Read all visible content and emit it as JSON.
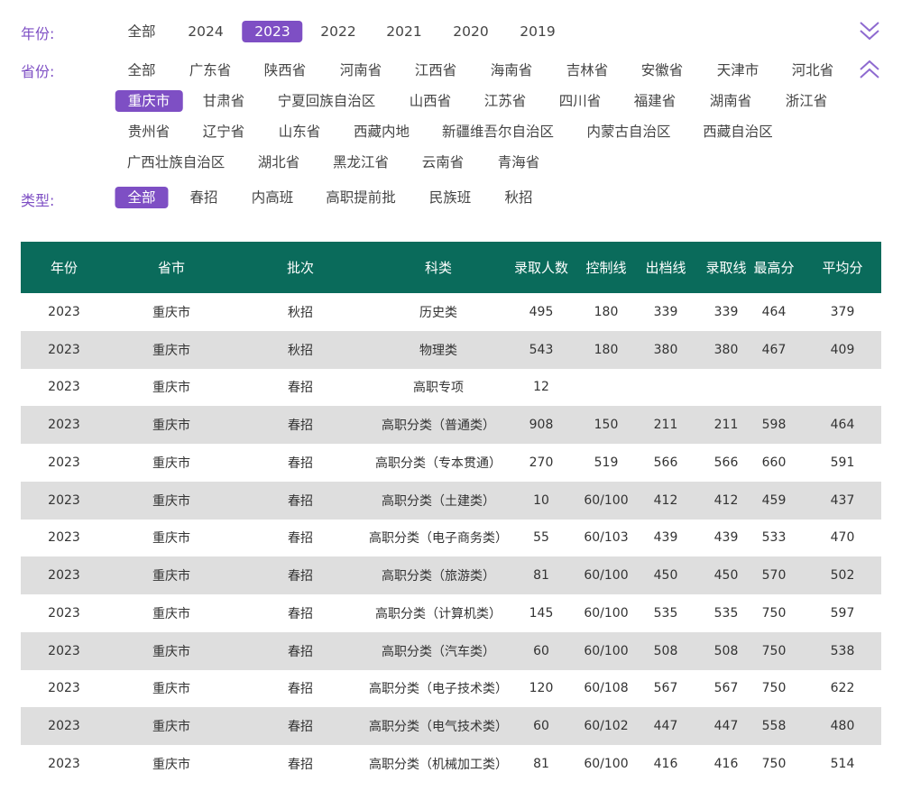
{
  "filters": {
    "year": {
      "label": "年份:",
      "options": [
        "全部",
        "2024",
        "2023",
        "2022",
        "2021",
        "2020",
        "2019"
      ],
      "selected": "2023"
    },
    "province": {
      "label": "省份:",
      "options": [
        "全部",
        "广东省",
        "陕西省",
        "河南省",
        "江西省",
        "海南省",
        "吉林省",
        "安徽省",
        "天津市",
        "河北省",
        "重庆市",
        "甘肃省",
        "宁夏回族自治区",
        "山西省",
        "江苏省",
        "四川省",
        "福建省",
        "湖南省",
        "浙江省",
        "贵州省",
        "辽宁省",
        "山东省",
        "西藏内地",
        "新疆维吾尔自治区",
        "内蒙古自治区",
        "西藏自治区",
        "广西壮族自治区",
        "湖北省",
        "黑龙江省",
        "云南省",
        "青海省"
      ],
      "selected": "重庆市"
    },
    "type": {
      "label": "类型:",
      "options": [
        "全部",
        "春招",
        "内高班",
        "高职提前批",
        "民族班",
        "秋招"
      ],
      "selected": "全部"
    }
  },
  "icons": {
    "collapse": "chevron-double-down-icon",
    "expand": "chevron-double-up-icon",
    "accent": "#7e4fc4",
    "header_bg": "#0a6b5b"
  },
  "table": {
    "headers": [
      "年份",
      "省市",
      "批次",
      "科类",
      "录取人数",
      "控制线",
      "出档线",
      "录取线",
      "最高分",
      "平均分"
    ],
    "rows": [
      [
        "2023",
        "重庆市",
        "秋招",
        "历史类",
        "495",
        "180",
        "339",
        "339",
        "464",
        "379"
      ],
      [
        "2023",
        "重庆市",
        "秋招",
        "物理类",
        "543",
        "180",
        "380",
        "380",
        "467",
        "409"
      ],
      [
        "2023",
        "重庆市",
        "春招",
        "高职专项",
        "12",
        "",
        "",
        "",
        "",
        ""
      ],
      [
        "2023",
        "重庆市",
        "春招",
        "高职分类（普通类）",
        "908",
        "150",
        "211",
        "211",
        "598",
        "464"
      ],
      [
        "2023",
        "重庆市",
        "春招",
        "高职分类（专本贯通）",
        "270",
        "519",
        "566",
        "566",
        "660",
        "591"
      ],
      [
        "2023",
        "重庆市",
        "春招",
        "高职分类（土建类）",
        "10",
        "60/100",
        "412",
        "412",
        "459",
        "437"
      ],
      [
        "2023",
        "重庆市",
        "春招",
        "高职分类（电子商务类）",
        "55",
        "60/103",
        "439",
        "439",
        "533",
        "470"
      ],
      [
        "2023",
        "重庆市",
        "春招",
        "高职分类（旅游类）",
        "81",
        "60/100",
        "450",
        "450",
        "570",
        "502"
      ],
      [
        "2023",
        "重庆市",
        "春招",
        "高职分类（计算机类）",
        "145",
        "60/100",
        "535",
        "535",
        "750",
        "597"
      ],
      [
        "2023",
        "重庆市",
        "春招",
        "高职分类（汽车类）",
        "60",
        "60/100",
        "508",
        "508",
        "750",
        "538"
      ],
      [
        "2023",
        "重庆市",
        "春招",
        "高职分类（电子技术类）",
        "120",
        "60/108",
        "567",
        "567",
        "750",
        "622"
      ],
      [
        "2023",
        "重庆市",
        "春招",
        "高职分类（电气技术类）",
        "60",
        "60/102",
        "447",
        "447",
        "558",
        "480"
      ],
      [
        "2023",
        "重庆市",
        "春招",
        "高职分类（机械加工类）",
        "81",
        "60/100",
        "416",
        "416",
        "750",
        "514"
      ]
    ]
  }
}
